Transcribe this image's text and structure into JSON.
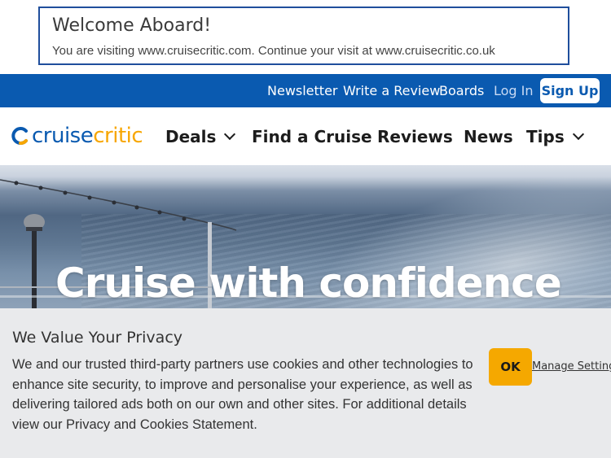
{
  "welcome": {
    "title": "Welcome Aboard!",
    "message": "You are visiting www.cruisecritic.com.  Continue your visit at www.cruisecritic.co.uk"
  },
  "utility_bar": {
    "links": [
      "Newsletter",
      "Write a Review",
      "Boards",
      "Log In"
    ],
    "signup_label": "Sign Up",
    "color": "#0a5ab0"
  },
  "logo": {
    "part1": "cruise",
    "part2": "critic",
    "color_primary": "#0a5ab0",
    "color_accent": "#f7a600"
  },
  "main_nav": {
    "items": [
      "Deals",
      "Find a Cruise",
      "Reviews",
      "News",
      "Tips"
    ]
  },
  "hero": {
    "title": "Cruise with confidence"
  },
  "privacy": {
    "title": "We Value Your Privacy",
    "body": "We and our trusted third-party partners use cookies and other technologies to enhance site security, to improve and personalise your experience, as well as delivering tailored ads both on our own and other sites. For additional details view our Privacy and Cookies Statement.",
    "ok_label": "OK",
    "manage_label": "Manage Settings",
    "ok_color": "#f5a800"
  }
}
